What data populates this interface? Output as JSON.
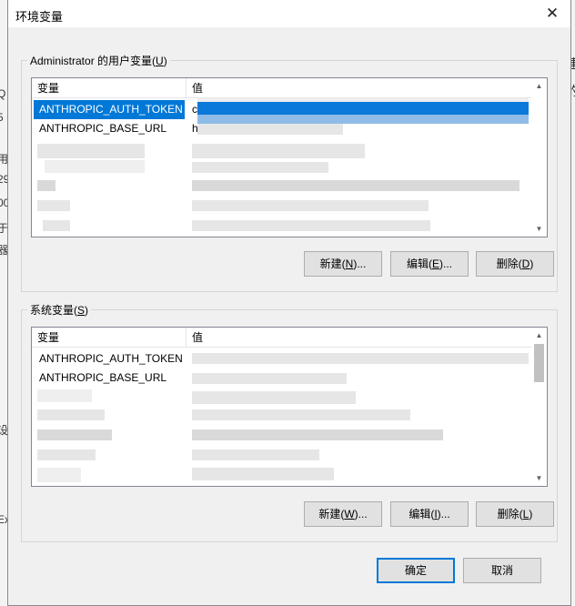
{
  "window": {
    "title": "环境变量",
    "close_glyph": "✕"
  },
  "user_vars": {
    "label_prefix": "Administrator 的用户变量(",
    "label_key": "U",
    "label_suffix": ")",
    "columns": [
      "变量",
      "值"
    ],
    "rows": [
      {
        "name": "ANTHROPIC_AUTH_TOKEN",
        "value": "c",
        "selected": true
      },
      {
        "name": "ANTHROPIC_BASE_URL",
        "value": "h",
        "selected": false
      }
    ],
    "buttons": {
      "new": {
        "pre": "新建(",
        "key": "N",
        "post": ")..."
      },
      "edit": {
        "pre": "编辑(",
        "key": "E",
        "post": ")..."
      },
      "delete": {
        "pre": "删除(",
        "key": "D",
        "post": ")"
      }
    }
  },
  "system_vars": {
    "label_prefix": "系统变量(",
    "label_key": "S",
    "label_suffix": ")",
    "columns": [
      "变量",
      "值"
    ],
    "rows": [
      {
        "name": "ANTHROPIC_AUTH_TOKEN",
        "value": ""
      },
      {
        "name": "ANTHROPIC_BASE_URL",
        "value": ""
      }
    ],
    "buttons": {
      "new": {
        "pre": "新建(",
        "key": "W",
        "post": ")..."
      },
      "edit": {
        "pre": "编辑(",
        "key": "I",
        "post": ")..."
      },
      "delete": {
        "pre": "删除(",
        "key": "L",
        "post": ")"
      }
    }
  },
  "footer": {
    "ok": "确定",
    "cancel": "取消"
  },
  "background": {
    "left_fragments": [
      "Q",
      "5",
      "用",
      "29",
      "00",
      "于",
      "器",
      "设",
      "Ex"
    ],
    "right_fragments": [
      "建",
      "的"
    ]
  },
  "colors": {
    "selection": "#0078d7",
    "dialog_bg": "#f0f0f0",
    "primary_border": "#0078d7"
  }
}
